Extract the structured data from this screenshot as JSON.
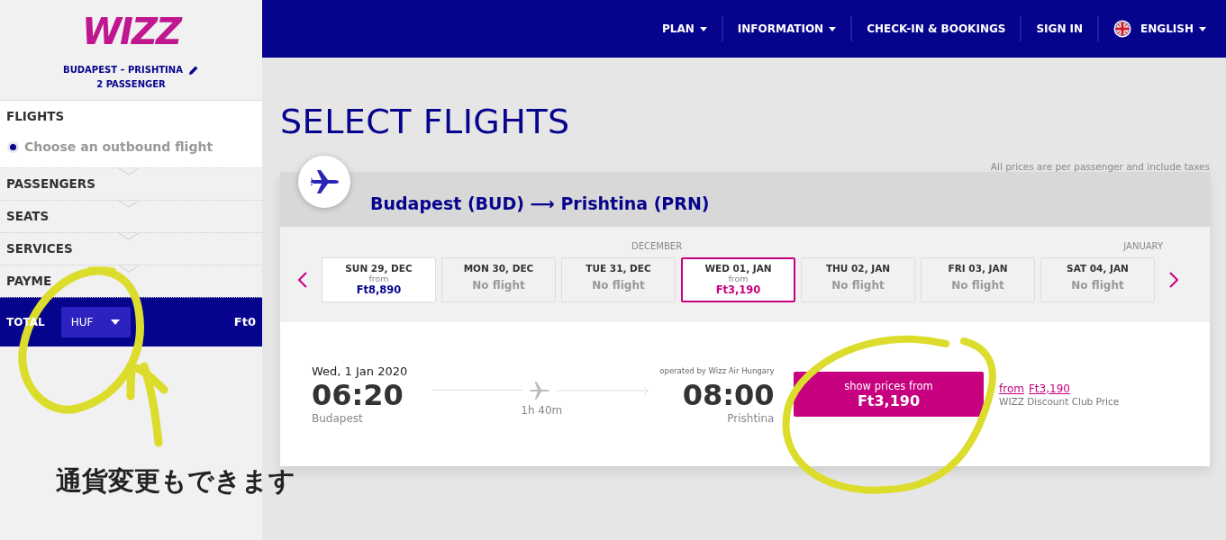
{
  "logo": "WIZZ",
  "trip": {
    "route": "BUDAPEST – PRISHTINA",
    "passengers": "2 PASSENGER"
  },
  "steps": [
    {
      "label": "FLIGHTS",
      "expanded": true,
      "sub": "Choose an outbound flight"
    },
    {
      "label": "PASSENGERS",
      "expanded": false
    },
    {
      "label": "SEATS",
      "expanded": false
    },
    {
      "label": "SERVICES",
      "expanded": false
    },
    {
      "label": "PAYME",
      "expanded": false
    }
  ],
  "total": {
    "label": "TOTAL",
    "currency": "HUF",
    "amount": "Ft0"
  },
  "nav": [
    {
      "label": "PLAN",
      "kind": "menu"
    },
    {
      "label": "INFORMATION",
      "kind": "menu"
    },
    {
      "label": "CHECK-IN & BOOKINGS",
      "kind": "link"
    },
    {
      "label": "SIGN IN",
      "kind": "link"
    },
    {
      "label": "ENGLISH",
      "kind": "language"
    }
  ],
  "title": "SELECT FLIGHTS",
  "note": "All prices are per passenger and include taxes",
  "route": {
    "from": "Budapest (BUD)",
    "arrow": "⟶",
    "to": "Prishtina (PRN)"
  },
  "months": [
    "DECEMBER",
    "JANUARY"
  ],
  "dates": [
    {
      "day": "SUN 29, DEC",
      "from": "from",
      "price": "Ft8,890",
      "selected": false
    },
    {
      "day": "MON 30, DEC",
      "status": "No flight",
      "selected": false
    },
    {
      "day": "TUE 31, DEC",
      "status": "No flight",
      "selected": false
    },
    {
      "day": "WED 01, JAN",
      "from": "from",
      "price": "Ft3,190",
      "selected": true
    },
    {
      "day": "THU 02, JAN",
      "status": "No flight",
      "selected": false
    },
    {
      "day": "FRI 03, JAN",
      "status": "No flight",
      "selected": false
    },
    {
      "day": "SAT 04, JAN",
      "status": "No flight",
      "selected": false
    }
  ],
  "flight": {
    "date": "Wed, 1 Jan 2020",
    "departure": "06:20",
    "from": "Budapest",
    "duration": "1h 40m",
    "operator": "operated by Wizz Air Hungary",
    "arrival": "08:00",
    "to": "Prishtina",
    "button_label": "show prices from",
    "button_price": "Ft3,190",
    "club_from": "from",
    "club_price": "Ft3,190",
    "club_label": "WIZZ Discount Club Price"
  },
  "annotation": "通貨変更もできます"
}
